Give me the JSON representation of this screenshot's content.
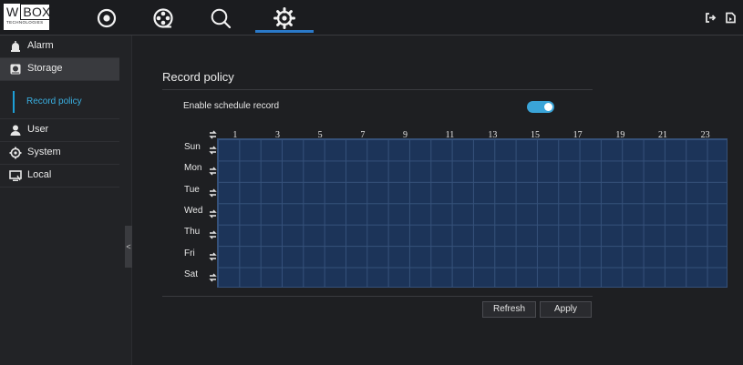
{
  "header": {
    "logo_main_a": "W",
    "logo_main_b": "BOX",
    "logo_sub": "TECHNOLOGIES",
    "nav": [
      {
        "icon": "live-view-icon",
        "active": false
      },
      {
        "icon": "playback-icon",
        "active": false
      },
      {
        "icon": "search-icon",
        "active": false
      },
      {
        "icon": "settings-icon",
        "active": true
      }
    ],
    "right_icons": [
      "logout-icon",
      "exit-icon"
    ]
  },
  "sidebar": {
    "items": [
      {
        "label": "Alarm",
        "icon": "alarm-icon"
      },
      {
        "label": "Storage",
        "icon": "storage-icon",
        "active": true
      },
      {
        "label": "User",
        "icon": "user-icon"
      },
      {
        "label": "System",
        "icon": "system-gear-icon"
      },
      {
        "label": "Local",
        "icon": "monitor-icon"
      }
    ],
    "subitem": {
      "label": "Record policy",
      "active": true
    },
    "collapse_glyph": "<"
  },
  "main": {
    "title": "Record policy",
    "enable_schedule_label": "Enable schedule record",
    "enable_schedule_on": true,
    "hours": [
      "1",
      "3",
      "5",
      "7",
      "9",
      "11",
      "13",
      "15",
      "17",
      "19",
      "21",
      "23"
    ],
    "days": [
      "Sun",
      "Mon",
      "Tue",
      "Wed",
      "Thu",
      "Fri",
      "Sat"
    ],
    "refresh_label": "Refresh",
    "apply_label": "Apply"
  },
  "colors": {
    "accent": "#2a79c9",
    "toggle_on": "#3aa4d8",
    "grid_fill": "#1c3459",
    "active_text": "#3ab0e2"
  }
}
